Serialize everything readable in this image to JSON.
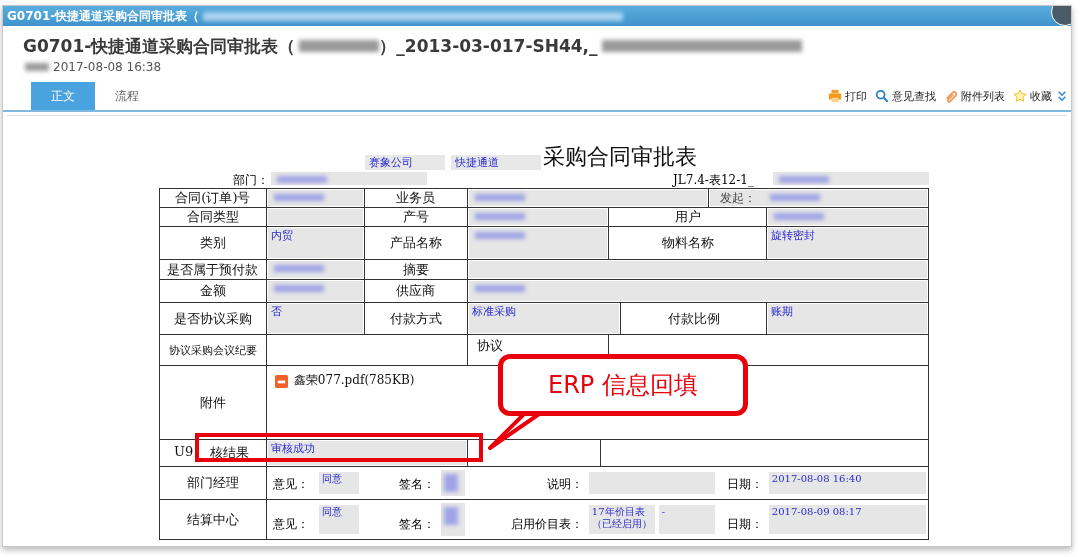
{
  "window": {
    "title": "G0701-快捷通道采购合同审批表（"
  },
  "header": {
    "title": "G0701-快捷通道采购合同审批表（",
    "title_rest": "）_2013-03-017-SH44,_",
    "date": "2017-08-08 16:38"
  },
  "tabs": [
    {
      "label": "正文",
      "selected": true
    },
    {
      "label": "流程",
      "selected": false
    }
  ],
  "toolbar": [
    {
      "label": "打印",
      "kind": "print"
    },
    {
      "label": "意见查找",
      "kind": "search"
    },
    {
      "label": "附件列表",
      "kind": "attach"
    },
    {
      "label": "收藏",
      "kind": "star"
    }
  ],
  "form": {
    "company": "赛象公司",
    "channel": "快捷通道",
    "title": "采购合同审批表",
    "dept_label": "部门：",
    "code": "JL7.4-表12-1_",
    "rows": [
      {
        "kind": "cells",
        "cells": [
          {
            "kind": "label",
            "text": "合同(订单)号"
          },
          {
            "kind": "redacted"
          },
          {
            "kind": "label",
            "text": "业务员"
          },
          {
            "kind": "redacted"
          },
          {
            "kind": "prefixed",
            "text": "发起："
          }
        ]
      },
      {
        "kind": "cells",
        "cells": [
          {
            "kind": "label",
            "text": "合同类型"
          },
          {
            "kind": "blank"
          },
          {
            "kind": "label",
            "text": "产号"
          },
          {
            "kind": "redacted"
          },
          {
            "kind": "label",
            "text": "用户"
          },
          {
            "kind": "redacted"
          }
        ]
      },
      {
        "kind": "cells",
        "cells": [
          {
            "kind": "label",
            "text": "类别"
          },
          {
            "kind": "value",
            "text": "内贸"
          },
          {
            "kind": "label",
            "text": "产品名称"
          },
          {
            "kind": "redacted"
          },
          {
            "kind": "label",
            "text": "物料名称"
          },
          {
            "kind": "value",
            "text": "旋转密封"
          }
        ]
      },
      {
        "kind": "cells",
        "cells": [
          {
            "kind": "label",
            "text": "是否属于预付款"
          },
          {
            "kind": "redacted"
          },
          {
            "kind": "label",
            "text": "摘要"
          },
          {
            "kind": "blank"
          }
        ]
      },
      {
        "kind": "cells",
        "cells": [
          {
            "kind": "label",
            "text": "金额"
          },
          {
            "kind": "redacted"
          },
          {
            "kind": "label",
            "text": "供应商"
          },
          {
            "kind": "redacted"
          }
        ]
      },
      {
        "kind": "cells",
        "cells": [
          {
            "kind": "label",
            "text": "是否协议采购"
          },
          {
            "kind": "value",
            "text": "否"
          },
          {
            "kind": "label",
            "text": "付款方式"
          },
          {
            "kind": "value",
            "text": "标准采购"
          },
          {
            "kind": "label",
            "text": "付款比例"
          },
          {
            "kind": "value",
            "text": "账期"
          }
        ]
      },
      {
        "kind": "cells",
        "cells": [
          {
            "kind": "small-label",
            "text": "协议采购会议纪要"
          },
          {
            "kind": "empty"
          },
          {
            "kind": "cut-label",
            "text": "协议"
          },
          {
            "kind": "empty"
          }
        ]
      },
      {
        "kind": "attachment",
        "label": "附件",
        "file": "鑫荣077.pdf(785KB)"
      },
      {
        "kind": "cells",
        "cells": [
          {
            "kind": "split-label",
            "texts": [
              "U9",
              "核结果"
            ]
          },
          {
            "kind": "value",
            "text": "审核成功"
          },
          {
            "kind": "empty"
          },
          {
            "kind": "empty"
          }
        ]
      },
      {
        "kind": "sign",
        "label": "部门经理",
        "parts": [
          {
            "kind": "label",
            "text": "意见："
          },
          {
            "kind": "value",
            "text": "同意"
          },
          {
            "kind": "label",
            "text": "签名："
          },
          {
            "kind": "redacted"
          },
          {
            "kind": "label",
            "text": "说明："
          },
          {
            "kind": "blank"
          },
          {
            "kind": "label",
            "text": "日期："
          },
          {
            "kind": "value",
            "text": "2017-08-08 16:40"
          }
        ]
      },
      {
        "kind": "sign",
        "label": "结算中心",
        "parts": [
          {
            "kind": "label",
            "text": "意见："
          },
          {
            "kind": "value",
            "text": "同意"
          },
          {
            "kind": "label",
            "text": "签名："
          },
          {
            "kind": "redacted"
          },
          {
            "kind": "label",
            "text": "启用价目表："
          },
          {
            "kind": "value",
            "text": "17年价目表（已经启用）"
          },
          {
            "kind": "value",
            "text": "-"
          },
          {
            "kind": "label",
            "text": "日期："
          },
          {
            "kind": "value",
            "text": "2017-08-09 08:17"
          }
        ]
      }
    ]
  },
  "callout": {
    "text": "ERP 信息回填"
  }
}
